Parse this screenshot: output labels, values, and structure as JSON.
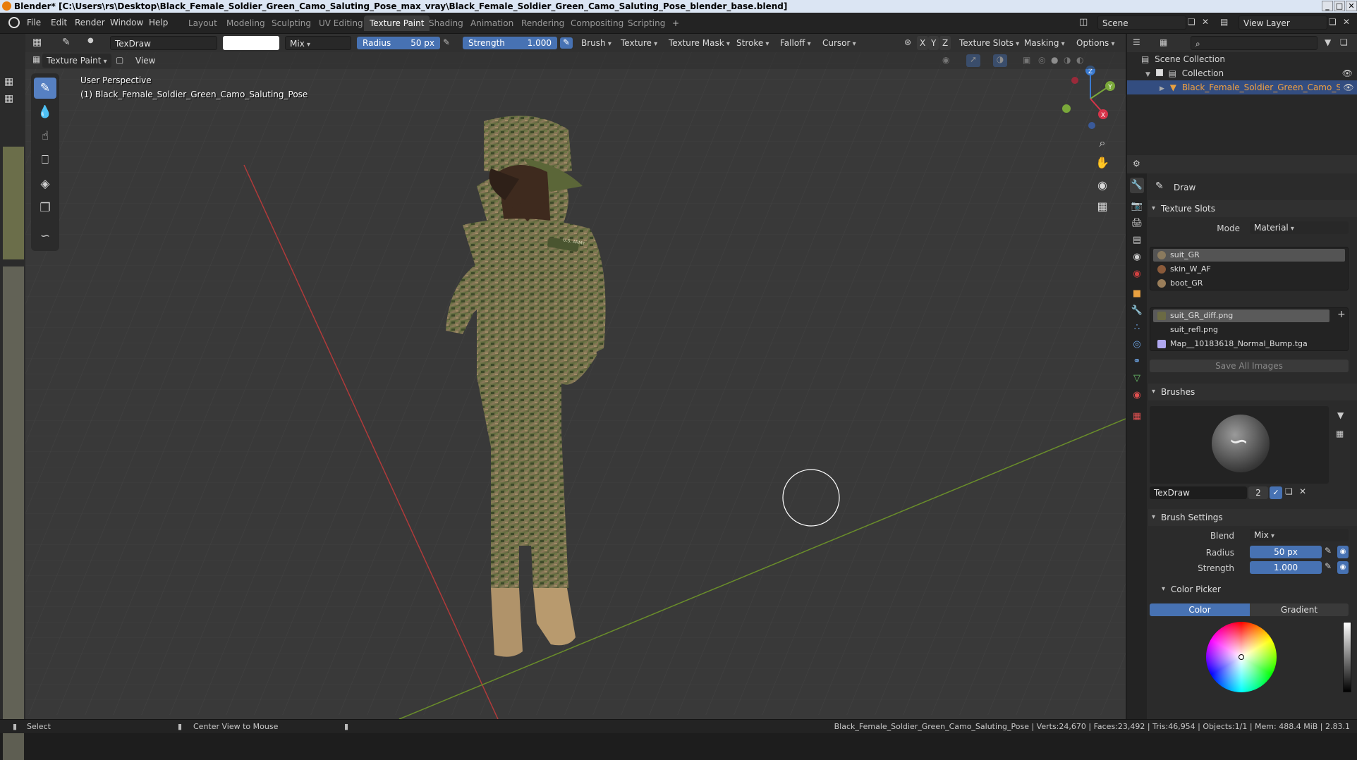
{
  "window": {
    "title": "Blender* [C:\\Users\\rs\\Desktop\\Black_Female_Soldier_Green_Camo_Saluting_Pose_max_vray\\Black_Female_Soldier_Green_Camo_Saluting_Pose_blender_base.blend]",
    "controls": [
      "_",
      "□",
      "✕"
    ]
  },
  "menu": {
    "items": [
      "File",
      "Edit",
      "Render",
      "Window",
      "Help"
    ]
  },
  "workspaces": {
    "tabs": [
      "Layout",
      "Modeling",
      "Sculpting",
      "UV Editing",
      "Texture Paint",
      "Shading",
      "Animation",
      "Rendering",
      "Compositing",
      "Scripting"
    ],
    "active": "Texture Paint",
    "add": "+"
  },
  "scene": {
    "name": "Scene",
    "view_layer": "View Layer"
  },
  "tool_header": {
    "brush_name": "TexDraw",
    "blend": "Mix",
    "radius_label": "Radius",
    "radius_value": "50 px",
    "strength_label": "Strength",
    "strength_value": "1.000",
    "menus": [
      "Brush",
      "Texture",
      "Texture Mask",
      "Stroke",
      "Falloff",
      "Cursor"
    ],
    "axes": [
      "X",
      "Y",
      "Z"
    ],
    "right_menus": [
      "Texture Slots",
      "Masking",
      "Options"
    ]
  },
  "mode_header": {
    "mode": "Texture Paint",
    "view": "View"
  },
  "viewport": {
    "perspective": "User Perspective",
    "object_label": "(1) Black_Female_Soldier_Green_Camo_Saluting_Pose",
    "gizmo_axes": {
      "z": "Z",
      "y": "Y",
      "x": "X"
    },
    "badge_text": "U.S. ARMY"
  },
  "outliner": {
    "search_placeholder": "",
    "scene_collection": "Scene Collection",
    "collection": "Collection",
    "object": "Black_Female_Soldier_Green_Camo_Saluting_Pose"
  },
  "properties": {
    "tool_name": "Draw",
    "texture_slots_header": "Texture Slots",
    "mode_label": "Mode",
    "mode_value": "Material",
    "materials": [
      {
        "name": "suit_GR",
        "color": "#8a7a5e"
      },
      {
        "name": "skin_W_AF",
        "color": "#8a5a3a"
      },
      {
        "name": "boot_GR",
        "color": "#9a7e5a"
      }
    ],
    "images": [
      {
        "name": "suit_GR_diff.png",
        "color": "#6b6a44"
      },
      {
        "name": "suit_refl.png",
        "color": ""
      },
      {
        "name": "Map__10183618_Normal_Bump.tga",
        "color": "#b0a8f0"
      }
    ],
    "save_all": "Save All Images",
    "brushes_header": "Brushes",
    "brush_name": "TexDraw",
    "brush_users": "2",
    "brush_settings_header": "Brush Settings",
    "blend_label": "Blend",
    "blend_value": "Mix",
    "radius_label": "Radius",
    "radius_value": "50 px",
    "strength_label": "Strength",
    "strength_value": "1.000",
    "color_picker_header": "Color Picker",
    "color_tab": "Color",
    "gradient_tab": "Gradient"
  },
  "status": {
    "select": "Select",
    "center_view": "Center View to Mouse",
    "info": "Black_Female_Soldier_Green_Camo_Saluting_Pose | Verts:24,670 | Faces:23,492 | Tris:46,954 | Objects:1/1 | Mem: 488.4 MiB | 2.83.1"
  },
  "icons": [
    "blender-logo-icon",
    "brush-icon",
    "fill-icon",
    "smear-icon",
    "clone-icon",
    "mask-icon",
    "annotate-icon",
    "zoom-icon",
    "hand-icon",
    "camera-icon",
    "grid-icon",
    "eye-icon",
    "search-icon",
    "filter-icon"
  ]
}
